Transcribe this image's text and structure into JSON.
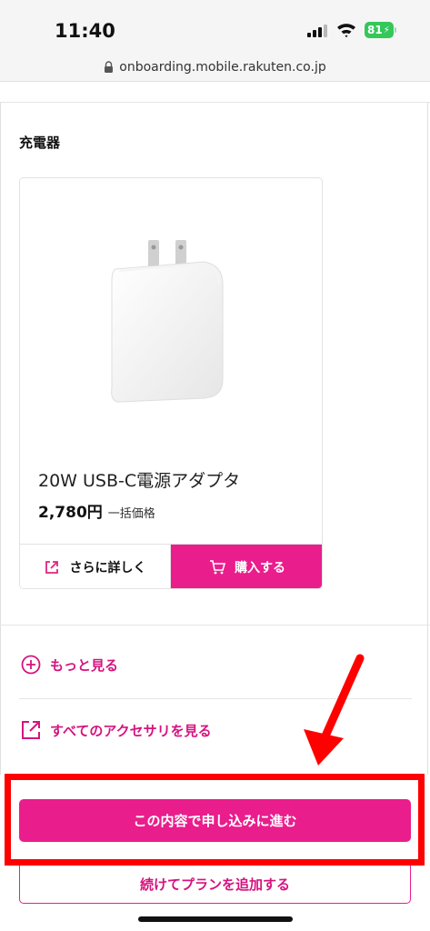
{
  "status_bar": {
    "time": "11:40",
    "battery": "81"
  },
  "browser": {
    "url": "onboarding.mobile.rakuten.co.jp"
  },
  "section": {
    "title": "充電器"
  },
  "product": {
    "name": "20W USB-C電源アダプタ",
    "price": "2,780円",
    "price_note": "一括価格",
    "details_label": "さらに詳しく",
    "buy_label": "購入する",
    "image_icon": "usb-c-power-adapter"
  },
  "links": {
    "more_label": "もっと見る",
    "accessories_label": "すべてのアクセサリを見る"
  },
  "actions": {
    "proceed_label": "この内容で申し込みに進む",
    "add_plan_label": "続けてプランを追加する"
  },
  "colors": {
    "accent": "#ea1d8c",
    "annotation": "#ff0000",
    "battery": "#34c759"
  }
}
